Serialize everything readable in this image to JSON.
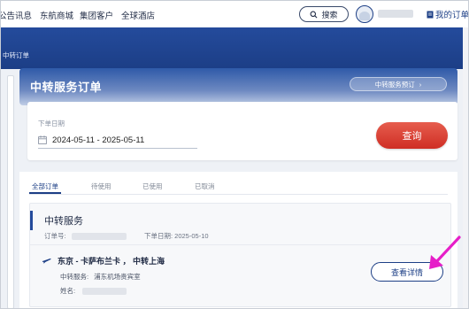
{
  "nav": {
    "items": [
      "公告讯息",
      "东航商城",
      "集团客户",
      "全球酒店"
    ],
    "search_label": "搜索",
    "my_orders_label": "我的订单"
  },
  "breadcrumb": "中转订单",
  "header": {
    "title": "中转服务订单",
    "book_button": "中转服务预订"
  },
  "filter": {
    "date_label": "下单日期",
    "date_range": "2024-05-11 - 2025-05-11",
    "query_button": "查询"
  },
  "tabs": [
    "全部订单",
    "待使用",
    "已使用",
    "已取消"
  ],
  "order": {
    "title": "中转服务",
    "order_no_label": "订单号:",
    "order_date": "下单日期: 2025-05-10",
    "route": "东京 - 卡萨布兰卡 ， 中转上海",
    "service_label": "中转服务:",
    "service_value": "浦东机场贵宾室",
    "name_label": "姓名:",
    "detail_button": "查看详情"
  },
  "colors": {
    "brand_blue": "#1d3f86",
    "query_red": "#d9392d",
    "annotation_magenta": "#e61ec8"
  }
}
